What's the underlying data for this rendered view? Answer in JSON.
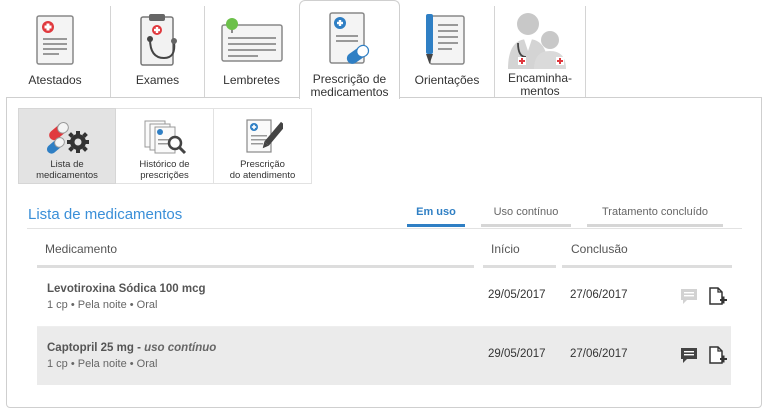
{
  "top_tabs": [
    {
      "label": "Atestados",
      "icon": "medical-certificate-icon"
    },
    {
      "label": "Exames",
      "icon": "clipboard-stethoscope-icon"
    },
    {
      "label": "Lembretes",
      "icon": "pinned-note-icon"
    },
    {
      "label": "Prescrição de medicamentos",
      "icon": "prescription-pill-icon"
    },
    {
      "label": "Orientações",
      "icon": "notes-pen-icon"
    },
    {
      "label": "Encaminha-mentos",
      "icon": "doctors-icon"
    }
  ],
  "top_tab_lines": {
    "prescricao": [
      "Prescrição de",
      "medicamentos"
    ],
    "encaminhamentos": [
      "Encaminha-",
      "mentos"
    ]
  },
  "sub_tabs": [
    {
      "line1": "Lista de",
      "line2": "medicamentos",
      "icon": "pills-gear-icon"
    },
    {
      "line1": "Histórico de",
      "line2": "prescrições",
      "icon": "documents-search-icon"
    },
    {
      "line1": "Prescrição",
      "line2": "do atendimento",
      "icon": "document-edit-icon"
    }
  ],
  "section_title": "Lista de medicamentos",
  "filters": [
    "Em uso",
    "Uso contínuo",
    "Tratamento concluído"
  ],
  "table": {
    "headers": [
      "Medicamento",
      "Início",
      "Conclusão"
    ],
    "rows": [
      {
        "name": "Levotiroxina Sódica 100 mcg",
        "tag": "",
        "detail": "1 cp • Pela noite • Oral",
        "start": "29/05/2017",
        "end": "27/06/2017"
      },
      {
        "name": "Captopril 25 mg - ",
        "tag": "uso contínuo",
        "detail": "1 cp • Pela noite • Oral",
        "start": "29/05/2017",
        "end": "27/06/2017"
      }
    ]
  },
  "colors": {
    "accent": "#3a8fd8",
    "active_filter": "#2f7fc4",
    "red_cross": "#e0393e"
  }
}
